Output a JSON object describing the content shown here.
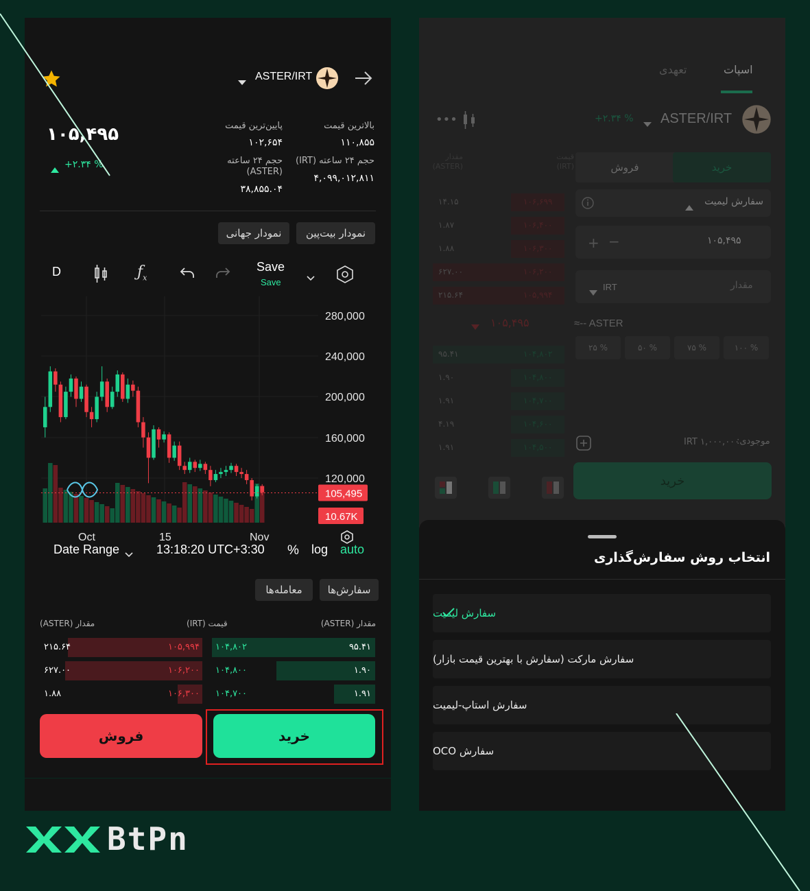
{
  "left": {
    "pair": "ASTER/IRT",
    "price": "۱۰۵,۴۹۵",
    "change": "+۲.۳۴ %",
    "stats": {
      "high_label": "بالاترین قیمت",
      "high_value": "۱۱۰,۸۵۵",
      "low_label": "پایین‌ترین قیمت",
      "low_value": "۱۰۲,۶۵۴",
      "vol_irt_label": "حجم ۲۴ ساعته (IRT)",
      "vol_irt_value": "۴,۰۹۹,۰۱۲,۸۱۱",
      "vol_aster_label": "حجم ۲۴ ساعته (ASTER)",
      "vol_aster_value": "۳۸,۸۵۵.۰۴"
    },
    "chart_tabs": [
      "نمودار بیت‌پین",
      "نمودار جهانی"
    ],
    "toolbar": {
      "interval": "D",
      "save": "Save",
      "save_sub": "Save"
    },
    "footer": {
      "date_range": "Date Range",
      "time": "13:18:20 UTC+3:30",
      "percent": "%",
      "log": "log",
      "auto": "auto"
    },
    "orders_tabs": [
      "سفارش‌ها",
      "معامله‌ها"
    ],
    "book_headers": [
      "مقدار (ASTER)",
      "قیمت (IRT)",
      "مقدار (ASTER)"
    ],
    "book_rows": [
      {
        "buy_amount": "۹۵.۴۱",
        "buy_price": "۱۰۴,۸۰۲",
        "sell_price": "۱۰۵,۹۹۴",
        "sell_amount": "۲۱۵.۶۴"
      },
      {
        "buy_amount": "۱.۹۰",
        "buy_price": "۱۰۴,۸۰۰",
        "sell_price": "۱۰۶,۲۰۰",
        "sell_amount": "۶۲۷.۰۰"
      },
      {
        "buy_amount": "۱.۹۱",
        "buy_price": "۱۰۴,۷۰۰",
        "sell_price": "۱۰۶,۳۰۰",
        "sell_amount": "۱.۸۸"
      }
    ],
    "sell_button": "فروش",
    "buy_button": "خرید"
  },
  "chart_data": {
    "type": "candlestick",
    "x_ticks": [
      "Oct",
      "15",
      "Nov"
    ],
    "y_ticks": [
      "280,000",
      "240,000",
      "200,000",
      "160,000",
      "120,000"
    ],
    "ylim": [
      100000,
      280000
    ],
    "last_price_label": "105,495",
    "volume_label": "10.67K",
    "candles": [
      [
        170000,
        190000,
        160000,
        200000
      ],
      [
        190000,
        225000,
        185000,
        230000
      ],
      [
        225000,
        212000,
        205000,
        228000
      ],
      [
        212000,
        180000,
        175000,
        215000
      ],
      [
        180000,
        205000,
        178000,
        210000
      ],
      [
        205000,
        218000,
        200000,
        222000
      ],
      [
        218000,
        198000,
        190000,
        220000
      ],
      [
        198000,
        210000,
        195000,
        215000
      ],
      [
        210000,
        185000,
        180000,
        212000
      ],
      [
        185000,
        178000,
        170000,
        190000
      ],
      [
        178000,
        200000,
        175000,
        205000
      ],
      [
        200000,
        215000,
        196000,
        230000
      ],
      [
        215000,
        190000,
        185000,
        218000
      ],
      [
        190000,
        205000,
        188000,
        210000
      ],
      [
        205000,
        222000,
        200000,
        226000
      ],
      [
        222000,
        198000,
        195000,
        224000
      ],
      [
        198000,
        212000,
        194000,
        218000
      ],
      [
        212000,
        206000,
        200000,
        216000
      ],
      [
        206000,
        175000,
        170000,
        210000
      ],
      [
        175000,
        160000,
        150000,
        180000
      ],
      [
        160000,
        140000,
        115000,
        165000
      ],
      [
        140000,
        168000,
        138000,
        172000
      ],
      [
        168000,
        158000,
        150000,
        170000
      ],
      [
        158000,
        163000,
        155000,
        166000
      ],
      [
        163000,
        140000,
        135000,
        165000
      ],
      [
        140000,
        152000,
        137000,
        156000
      ],
      [
        152000,
        132000,
        128000,
        156000
      ],
      [
        132000,
        128000,
        124000,
        136000
      ],
      [
        128000,
        136000,
        125000,
        140000
      ],
      [
        136000,
        130000,
        126000,
        138000
      ],
      [
        130000,
        134000,
        127000,
        138000
      ],
      [
        134000,
        128000,
        124000,
        136000
      ],
      [
        128000,
        118000,
        112000,
        132000
      ],
      [
        118000,
        124000,
        116000,
        128000
      ],
      [
        124000,
        126000,
        120000,
        130000
      ],
      [
        126000,
        128000,
        122000,
        132000
      ],
      [
        128000,
        132000,
        125000,
        135000
      ],
      [
        132000,
        126000,
        122000,
        134000
      ],
      [
        126000,
        124000,
        120000,
        130000
      ],
      [
        124000,
        118000,
        114000,
        128000
      ],
      [
        118000,
        102000,
        98000,
        120000
      ],
      [
        102000,
        112000,
        100000,
        114000
      ],
      [
        112000,
        106000,
        103000,
        114000
      ]
    ]
  },
  "right": {
    "tabs": [
      "اسپات",
      "تعهدی"
    ],
    "pair": "ASTER/IRT",
    "change": "+۲.۳۴ %",
    "buy_tab": "خرید",
    "sell_tab": "فروش",
    "order_type": "سفارش لیمیت",
    "price_value": "۱۰۵,۴۹۵",
    "amount_placeholder": "مقدار",
    "amount_unit": "IRT",
    "approx_unit": "ASTER",
    "percents": [
      "۲۵ %",
      "۵۰ %",
      "۷۵ %",
      "۱۰۰ %"
    ],
    "balance_label": "موجودی:",
    "balance_value": "IRT ۱,۰۰۰,۰۰۰",
    "buy_button": "خرید",
    "book_headers": [
      "مقدار (ASTER)",
      "قیمت (IRT)"
    ],
    "sell_rows": [
      [
        "۱۴.۱۵",
        "۱۰۶,۶۹۹"
      ],
      [
        "۱.۸۷",
        "۱۰۶,۴۰۰"
      ],
      [
        "۱.۸۸",
        "۱۰۶,۳۰۰"
      ],
      [
        "۶۲۷.۰۰",
        "۱۰۶,۲۰۰"
      ],
      [
        "۲۱۵.۶۴",
        "۱۰۵,۹۹۴"
      ]
    ],
    "mid_price": "۱۰۵,۴۹۵",
    "buy_rows": [
      [
        "۹۵.۴۱",
        "۱۰۴,۸۰۲"
      ],
      [
        "۱.۹۰",
        "۱۰۴,۸۰۰"
      ],
      [
        "۱.۹۱",
        "۱۰۴,۷۰۰"
      ],
      [
        "۴.۱۹",
        "۱۰۴,۶۰۰"
      ],
      [
        "۱.۹۱",
        "۱۰۴,۵۰۰"
      ]
    ],
    "sheet": {
      "title": "انتخاب روش سفارش‌گذاری",
      "options": [
        "سفارش لیمیت",
        "سفارش مارکت (سفارش با بهترین قیمت بازار)",
        "سفارش استاپ-لیمیت",
        "سفارش OCO"
      ]
    }
  },
  "brand": {
    "logo_left": "XX",
    "logo_right": "BtPn",
    "accent": "#2ee8a0",
    "red": "#ef3d46"
  }
}
